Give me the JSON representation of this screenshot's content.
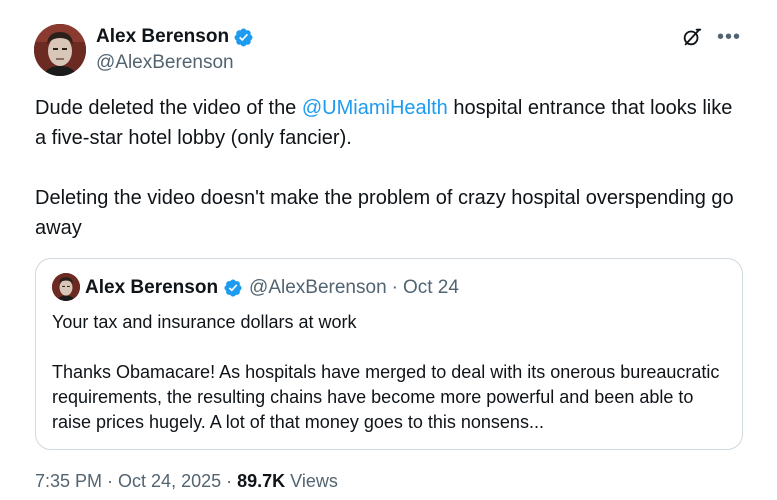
{
  "author": {
    "display_name": "Alex Berenson",
    "handle": "@AlexBerenson"
  },
  "tweet": {
    "paragraph1_before": "Dude deleted the video of the ",
    "mention": "@UMiamiHealth",
    "paragraph1_after": " hospital entrance that looks like a five-star hotel lobby (only fancier).",
    "paragraph2": "Deleting the video doesn't make the problem of crazy hospital overspending go away"
  },
  "quote": {
    "display_name": "Alex Berenson",
    "handle": "@AlexBerenson",
    "separator": "·",
    "date": "Oct 24",
    "line1": "Your tax and insurance dollars at work",
    "body": "Thanks Obamacare! As hospitals have merged to deal with its onerous bureaucratic requirements, the resulting chains have become more powerful and been able to raise prices hugely. A lot of that money goes to this nonsens..."
  },
  "meta": {
    "time": "7:35 PM",
    "separator": "·",
    "date": "Oct 24, 2025",
    "views_count": "89.7K",
    "views_label": "Views"
  },
  "icons": {
    "verified": "verified-badge-icon",
    "grok": "grok-icon",
    "more": "more-options-icon"
  },
  "colors": {
    "accent": "#1d9bf0",
    "text": "#0f1419",
    "secondary": "#536471",
    "border": "#cfd9de"
  }
}
